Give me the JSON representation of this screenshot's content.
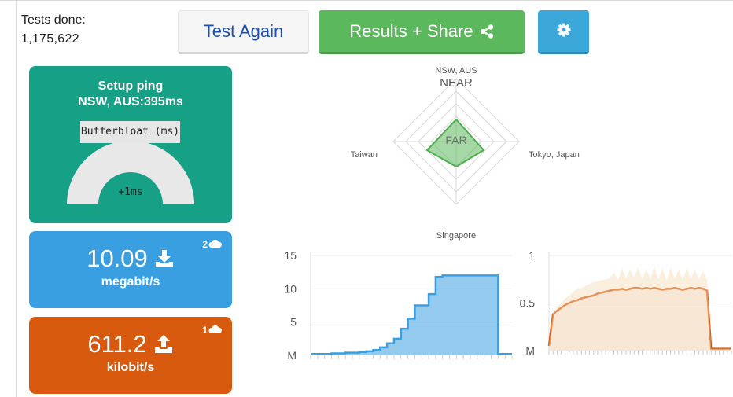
{
  "tests_done": {
    "label": "Tests done:",
    "count": "1,175,622"
  },
  "toolbar": {
    "test_again_label": "Test Again",
    "results_label": "Results + Share",
    "colors": {
      "test_again_text": "#1d4fae",
      "results_bg": "#5cb85c",
      "settings_bg": "#3aa7d8"
    }
  },
  "ping_card": {
    "line1": "Setup ping",
    "line2": "NSW, AUS:395ms",
    "bufferbloat_label": "Bufferbloat (ms)",
    "bufferbloat_value": "+1ms",
    "color": "#16a085"
  },
  "download_card": {
    "value": "10.09",
    "unit": "megabit/s",
    "server_count": "2",
    "color": "#3a9fe0"
  },
  "upload_card": {
    "value": "611.2",
    "unit": "kilobit/s",
    "server_count": "1",
    "color": "#d75a0e"
  },
  "radar": {
    "top_label": "NSW, AUS",
    "near_label": "NEAR",
    "far_label": "FAR",
    "left_label": "Taiwan",
    "right_label": "Tokyo, Japan",
    "bottom_label": "Singapore",
    "color": "#5cb85c"
  },
  "chart_data": [
    {
      "type": "area",
      "series": [
        {
          "values": [
            0.2,
            0.2,
            0.2,
            0.3,
            0.3,
            0.4,
            0.4,
            0.5,
            0.6,
            0.8,
            1.2,
            1.8,
            2.5,
            4.0,
            5.5,
            7.5,
            7.5,
            9.2,
            11.8,
            12.0,
            12.0,
            12.0,
            12.0,
            12.0,
            12.0,
            12.0,
            12.0,
            0.2,
            0.2,
            0.2
          ]
        }
      ],
      "ylim": [
        0,
        15
      ],
      "ytick_labels": [
        "15",
        "10",
        "5",
        "M"
      ],
      "ytick_values": [
        15,
        10,
        5,
        0
      ],
      "color": "#3a9fe0"
    },
    {
      "type": "line",
      "series": [
        {
          "values": [
            0.05,
            0.38,
            0.42,
            0.45,
            0.48,
            0.5,
            0.52,
            0.53,
            0.55,
            0.56,
            0.57,
            0.58,
            0.6,
            0.61,
            0.62,
            0.63,
            0.64,
            0.64,
            0.65,
            0.64,
            0.65,
            0.66,
            0.66,
            0.65,
            0.66,
            0.65,
            0.66,
            0.65,
            0.64,
            0.65,
            0.65,
            0.66,
            0.65,
            0.64,
            0.65,
            0.66,
            0.65,
            0.66,
            0.65,
            0.63,
            0.02,
            0.02,
            0.02,
            0.02,
            0.02,
            0.02
          ]
        },
        {
          "values": [
            0.05,
            0.4,
            0.46,
            0.5,
            0.55,
            0.58,
            0.62,
            0.65,
            0.66,
            0.68,
            0.7,
            0.72,
            0.73,
            0.74,
            0.75,
            0.76,
            0.82,
            0.74,
            0.86,
            0.76,
            0.85,
            0.77,
            0.87,
            0.75,
            0.86,
            0.76,
            0.88,
            0.75,
            0.86,
            0.74,
            0.87,
            0.76,
            0.85,
            0.75,
            0.86,
            0.76,
            0.85,
            0.75,
            0.84,
            0.74,
            0.02,
            0.02,
            0.02,
            0.02,
            0.02,
            0.02
          ]
        }
      ],
      "ylim": [
        0,
        1
      ],
      "ytick_labels": [
        "1",
        "0.5",
        "M"
      ],
      "ytick_values": [
        1,
        0.5,
        0
      ],
      "color": "#d75a0e"
    }
  ]
}
